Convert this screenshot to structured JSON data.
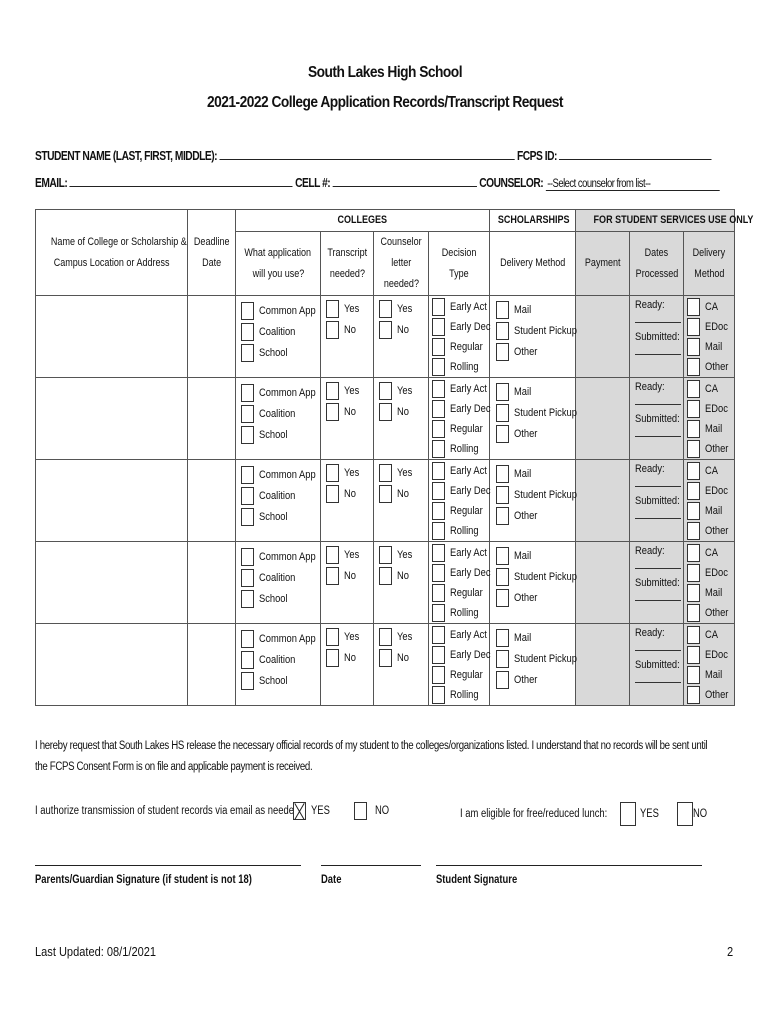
{
  "header": {
    "school": "South Lakes High School",
    "form_title": "2021-2022 College Application Records/Transcript Request"
  },
  "student_fields": {
    "name_label": "STUDENT NAME (LAST, FIRST, MIDDLE):",
    "name_value": "",
    "fcps_id_label": "FCPS ID:",
    "fcps_id_value": "",
    "email_label": "EMAIL:",
    "email_value": "",
    "cell_label": "CELL #:",
    "cell_value": "",
    "counselor_label": "COUNSELOR:",
    "counselor_selected": "--Select counselor from list--"
  },
  "table": {
    "group_headers": {
      "colleges": "COLLEGES",
      "scholarships": "SCHOLARSHIPS",
      "student_services": "FOR STUDENT SERVICES USE ONLY"
    },
    "columns": {
      "name": [
        "Name of College or Scholarship &",
        "Campus Location or Address"
      ],
      "deadline": [
        "Deadline",
        "Date"
      ],
      "application": [
        "What application",
        "will you use?"
      ],
      "transcript": [
        "Transcript",
        "needed?"
      ],
      "counselor_letter": [
        "Counselor",
        "letter",
        "needed?"
      ],
      "decision": [
        "Decision",
        "Type"
      ],
      "delivery": "Delivery Method",
      "payment": "Payment",
      "dates_processed": [
        "Dates",
        "Processed"
      ],
      "delivery_method_ss": [
        "Delivery",
        "Method"
      ]
    },
    "options": {
      "application": [
        "Common App",
        "Coalition",
        "School"
      ],
      "transcript": [
        "Yes",
        "No"
      ],
      "counselor_letter": [
        "Yes",
        "No"
      ],
      "decision": [
        "Early Act",
        "Early Dec",
        "Regular",
        "Rolling"
      ],
      "delivery": [
        "Mail",
        "Student Pickup",
        "Other"
      ],
      "dates_processed": [
        "Ready:",
        "Submitted:"
      ],
      "delivery_method_ss": [
        "CA",
        "EDoc",
        "Mail",
        "Other"
      ]
    },
    "rows": [
      {
        "name": "",
        "deadline": ""
      },
      {
        "name": "",
        "deadline": ""
      },
      {
        "name": "",
        "deadline": ""
      },
      {
        "name": "",
        "deadline": ""
      },
      {
        "name": "",
        "deadline": ""
      }
    ]
  },
  "consent": {
    "line1": "I hereby request that South Lakes HS release the necessary official records of my student to the colleges/organizations listed. I understand that no records will be sent until",
    "line2": "the FCPS Consent Form is on file and applicable payment is received."
  },
  "authorization": {
    "email_label": "I authorize transmission of student records via email as needed:",
    "email_yes": "YES",
    "email_no": "NO",
    "email_yes_checked": true,
    "email_no_checked": false,
    "lunch_label": "I am eligible for free/reduced lunch:",
    "lunch_yes": "YES",
    "lunch_no": "NO",
    "lunch_yes_checked": false,
    "lunch_no_checked": false
  },
  "signatures": {
    "parent": "Parents/Guardian Signature (if student is not 18)",
    "date": "Date",
    "student": "Student Signature"
  },
  "footer": {
    "last_updated": "Last Updated: 08/1/2021",
    "page_number": "2"
  }
}
